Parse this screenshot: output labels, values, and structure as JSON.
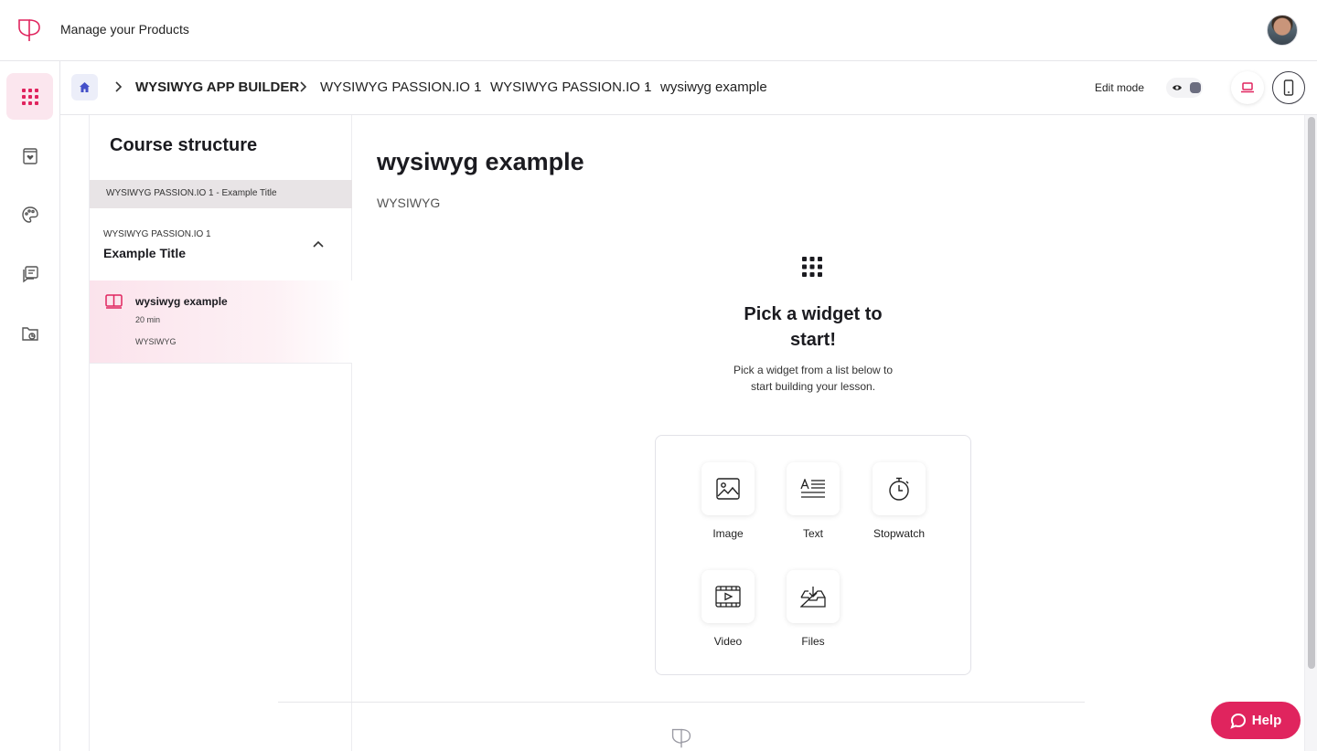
{
  "header": {
    "app_title": "Manage your Products"
  },
  "breadcrumb": {
    "items": [
      "WYSIWYG APP BUILDER",
      "WYSIWYG PASSION.IO 1",
      "WYSIWYG PASSION.IO 1",
      "wysiwyg example"
    ],
    "edit_mode_label": "Edit mode"
  },
  "sidebar": {
    "icons": [
      "apps-grid-icon",
      "product-icon",
      "palette-icon",
      "feedback-icon",
      "folder-chart-icon"
    ]
  },
  "course": {
    "title": "Course structure",
    "section_label": "WYSIWYG PASSION.IO 1 - Example Title",
    "module_sub": "WYSIWYG PASSION.IO 1",
    "module_title": "Example Title",
    "lesson": {
      "title": "wysiwyg example",
      "duration": "20 min",
      "tag": "WYSIWYG"
    }
  },
  "main": {
    "title": "wysiwyg example",
    "subtitle": "WYSIWYG",
    "pick_title": "Pick a widget to start!",
    "pick_desc": "Pick a widget from a list below to start building your lesson.",
    "widgets": [
      "Image",
      "Text",
      "Stopwatch",
      "Video",
      "Files"
    ]
  },
  "help": {
    "label": "Help"
  },
  "colors": {
    "brand": "#e0245e",
    "active_bg": "#fbe6ee"
  }
}
